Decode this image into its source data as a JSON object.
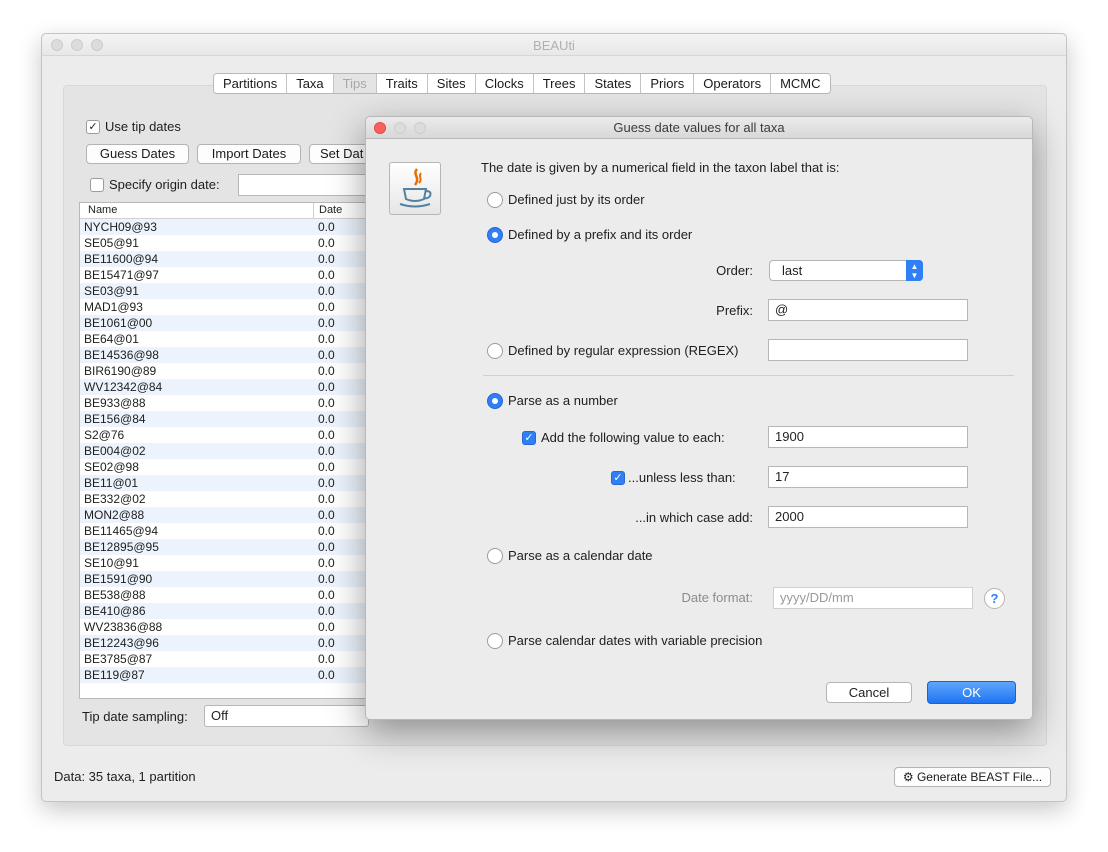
{
  "window": {
    "title": "BEAUti"
  },
  "tabs": [
    {
      "label": "Partitions"
    },
    {
      "label": "Taxa"
    },
    {
      "label": "Tips"
    },
    {
      "label": "Traits"
    },
    {
      "label": "Sites"
    },
    {
      "label": "Clocks"
    },
    {
      "label": "Trees"
    },
    {
      "label": "States"
    },
    {
      "label": "Priors"
    },
    {
      "label": "Operators"
    },
    {
      "label": "MCMC"
    }
  ],
  "selected_tab": "Tips",
  "tips_panel": {
    "use_tip_dates_label": "Use tip dates",
    "use_tip_dates_checked": true,
    "guess_dates_label": "Guess Dates",
    "import_dates_label": "Import Dates",
    "set_dates_label": "Set Dat",
    "specify_origin_label": "Specify origin date:",
    "specify_origin_checked": false,
    "tip_date_sampling_label": "Tip date sampling:",
    "tip_date_sampling_value": "Off"
  },
  "table": {
    "columns": [
      "Name",
      "Date"
    ],
    "rows": [
      {
        "name": "NYCH09@93",
        "date": "0.0"
      },
      {
        "name": "SE05@91",
        "date": "0.0"
      },
      {
        "name": "BE11600@94",
        "date": "0.0"
      },
      {
        "name": "BE15471@97",
        "date": "0.0"
      },
      {
        "name": "SE03@91",
        "date": "0.0"
      },
      {
        "name": "MAD1@93",
        "date": "0.0"
      },
      {
        "name": "BE1061@00",
        "date": "0.0"
      },
      {
        "name": "BE64@01",
        "date": "0.0"
      },
      {
        "name": "BE14536@98",
        "date": "0.0"
      },
      {
        "name": "BIR6190@89",
        "date": "0.0"
      },
      {
        "name": "WV12342@84",
        "date": "0.0"
      },
      {
        "name": "BE933@88",
        "date": "0.0"
      },
      {
        "name": "BE156@84",
        "date": "0.0"
      },
      {
        "name": "S2@76",
        "date": "0.0"
      },
      {
        "name": "BE004@02",
        "date": "0.0"
      },
      {
        "name": "SE02@98",
        "date": "0.0"
      },
      {
        "name": "BE11@01",
        "date": "0.0"
      },
      {
        "name": "BE332@02",
        "date": "0.0"
      },
      {
        "name": "MON2@88",
        "date": "0.0"
      },
      {
        "name": "BE11465@94",
        "date": "0.0"
      },
      {
        "name": "BE12895@95",
        "date": "0.0"
      },
      {
        "name": "SE10@91",
        "date": "0.0"
      },
      {
        "name": "BE1591@90",
        "date": "0.0"
      },
      {
        "name": "BE538@88",
        "date": "0.0"
      },
      {
        "name": "BE410@86",
        "date": "0.0"
      },
      {
        "name": "WV23836@88",
        "date": "0.0"
      },
      {
        "name": "BE12243@96",
        "date": "0.0"
      },
      {
        "name": "BE3785@87",
        "date": "0.0"
      },
      {
        "name": "BE119@87",
        "date": "0.0"
      }
    ]
  },
  "status": {
    "data_summary": "Data: 35 taxa, 1 partition",
    "generate_label": "Generate BEAST File..."
  },
  "dialog": {
    "title": "Guess date values for all taxa",
    "intro": "The date is given by a numerical field in the taxon label that is:",
    "opt_order_only": "Defined just by its order",
    "opt_prefix_order": "Defined by a prefix and its order",
    "order_label": "Order:",
    "order_value": "last",
    "prefix_label": "Prefix:",
    "prefix_value": "@",
    "opt_regex": "Defined by regular expression (REGEX)",
    "regex_value": "",
    "opt_parse_number": "Parse as a number",
    "add_value_label": "Add the following value to each:",
    "add_value_checked": true,
    "add_value": "1900",
    "unless_label": "...unless less than:",
    "unless_checked": true,
    "unless_value": "17",
    "which_case_label": "...in which case add:",
    "which_case_value": "2000",
    "opt_calendar": "Parse as a calendar date",
    "date_format_label": "Date format:",
    "date_format_placeholder": "yyyy/DD/mm",
    "opt_variable_precision": "Parse calendar dates with variable precision",
    "cancel_label": "Cancel",
    "ok_label": "OK"
  },
  "icons": {
    "app_icon": "java-coffee-cup-icon",
    "help": "help-icon",
    "gear": "gear-icon"
  },
  "colors": {
    "accent": "#2f7ff5",
    "close": "#fc605c",
    "window_bg": "#ececec",
    "row_stripe": "#edf3fc"
  }
}
